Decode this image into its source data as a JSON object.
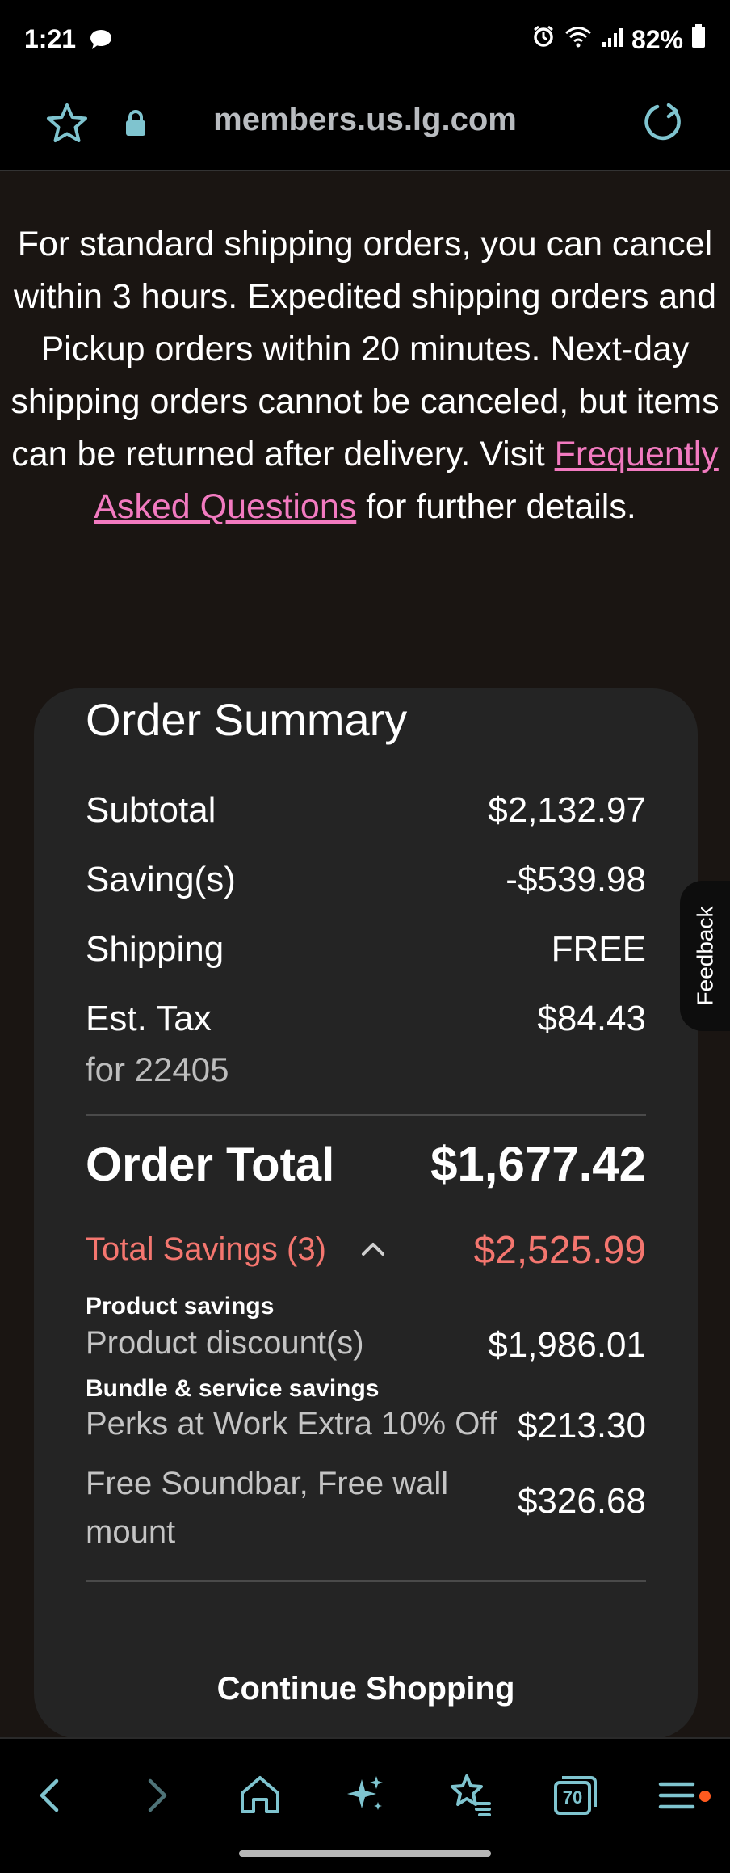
{
  "status_bar": {
    "time": "1:21",
    "battery": "82%"
  },
  "browser": {
    "url": "members.us.lg.com"
  },
  "notice": {
    "text_before": "For standard shipping orders, you can cancel within 3 hours. Expedited shipping orders and Pickup orders within 20 minutes. Next-day shipping orders cannot be canceled, but items can be returned after delivery. Visit ",
    "link_text": "Frequently Asked Questions",
    "text_after": " for further details."
  },
  "order_summary": {
    "title": "Order Summary",
    "subtotal_label": "Subtotal",
    "subtotal_value": "$2,132.97",
    "savings_label": "Saving(s)",
    "savings_value": "-$539.98",
    "shipping_label": "Shipping",
    "shipping_value": "FREE",
    "tax_label": "Est. Tax",
    "tax_value": "$84.43",
    "tax_zip": "for 22405",
    "total_label": "Order Total",
    "total_value": "$1,677.42",
    "total_savings_label": "Total Savings (3)",
    "total_savings_value": "$2,525.99",
    "product_savings_heading": "Product savings",
    "product_discount_label": "Product discount(s)",
    "product_discount_value": "$1,986.01",
    "bundle_heading": "Bundle & service savings",
    "perks_label": "Perks at Work Extra 10% Off",
    "perks_value": "$213.30",
    "soundbar_label": "Free Soundbar, Free wall mount",
    "soundbar_value": "$326.68",
    "continue_label": "Continue Shopping"
  },
  "feedback": {
    "label": "Feedback"
  },
  "bottom_nav": {
    "tab_count": "70"
  },
  "colors": {
    "accent": "#7fc4cf",
    "savings": "#f4766f",
    "link": "#f27ac0"
  }
}
